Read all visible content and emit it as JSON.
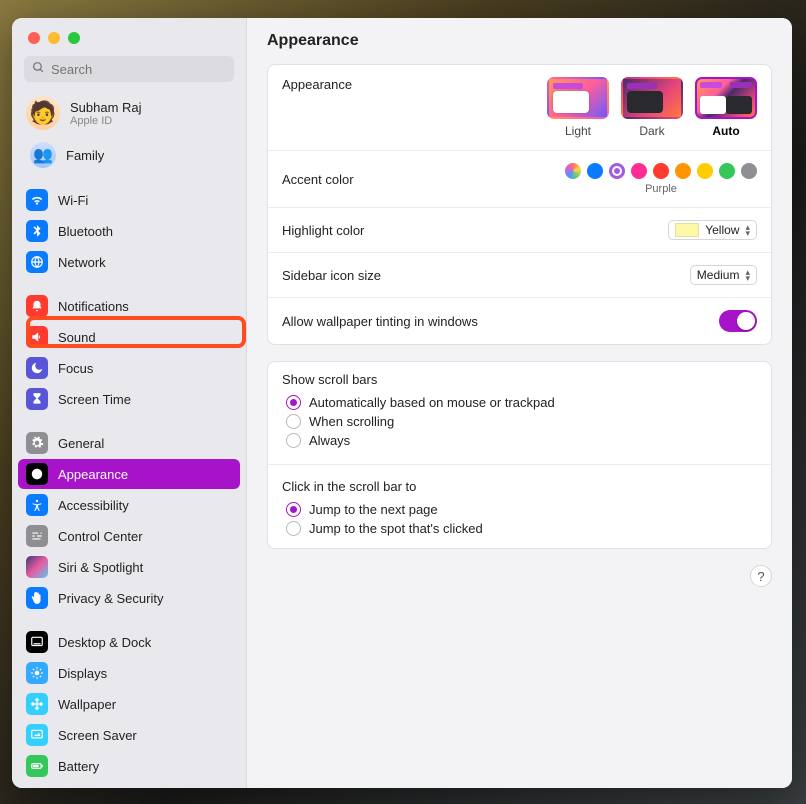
{
  "search": {
    "placeholder": "Search"
  },
  "account": {
    "name": "Subham Raj",
    "sub": "Apple ID",
    "family": "Family"
  },
  "sidebar_groups": [
    [
      {
        "id": "wifi",
        "label": "Wi-Fi",
        "color": "#0a7bff",
        "icon": "wifi"
      },
      {
        "id": "bluetooth",
        "label": "Bluetooth",
        "color": "#0a7bff",
        "icon": "bluetooth"
      },
      {
        "id": "network",
        "label": "Network",
        "color": "#0a7bff",
        "icon": "globe"
      }
    ],
    [
      {
        "id": "notifications",
        "label": "Notifications",
        "color": "#ff3b30",
        "icon": "bell",
        "annotated": true
      },
      {
        "id": "sound",
        "label": "Sound",
        "color": "#ff3b30",
        "icon": "speaker"
      },
      {
        "id": "focus",
        "label": "Focus",
        "color": "#5856d6",
        "icon": "moon"
      },
      {
        "id": "screen-time",
        "label": "Screen Time",
        "color": "#5856d6",
        "icon": "hourglass"
      }
    ],
    [
      {
        "id": "general",
        "label": "General",
        "color": "#8e8e93",
        "icon": "gear"
      },
      {
        "id": "appearance",
        "label": "Appearance",
        "color": "#000000",
        "icon": "appearance",
        "selected": true
      },
      {
        "id": "accessibility",
        "label": "Accessibility",
        "color": "#0a7bff",
        "icon": "accessibility"
      },
      {
        "id": "control-center",
        "label": "Control Center",
        "color": "#8e8e93",
        "icon": "sliders"
      },
      {
        "id": "siri",
        "label": "Siri & Spotlight",
        "color": "#000000",
        "icon": "siri",
        "multi": true
      },
      {
        "id": "privacy",
        "label": "Privacy & Security",
        "color": "#0a7bff",
        "icon": "hand"
      }
    ],
    [
      {
        "id": "desktop-dock",
        "label": "Desktop & Dock",
        "color": "#000000",
        "icon": "dock"
      },
      {
        "id": "displays",
        "label": "Displays",
        "color": "#33aaff",
        "icon": "sun"
      },
      {
        "id": "wallpaper",
        "label": "Wallpaper",
        "color": "#33cfff",
        "icon": "flower"
      },
      {
        "id": "screen-saver",
        "label": "Screen Saver",
        "color": "#33cfff",
        "icon": "screensaver"
      },
      {
        "id": "battery",
        "label": "Battery",
        "color": "#34c759",
        "icon": "battery"
      }
    ]
  ],
  "main": {
    "title": "Appearance",
    "appearance_label": "Appearance",
    "themes": [
      {
        "id": "light",
        "label": "Light"
      },
      {
        "id": "dark",
        "label": "Dark"
      },
      {
        "id": "auto",
        "label": "Auto",
        "selected": true
      }
    ],
    "accent_label": "Accent color",
    "accent_colors": [
      {
        "id": "multicolor",
        "hex": "multi"
      },
      {
        "id": "blue",
        "hex": "#0a7bff"
      },
      {
        "id": "purple",
        "hex": "#a55ae0",
        "selected": true
      },
      {
        "id": "pink",
        "hex": "#ff2d92"
      },
      {
        "id": "red",
        "hex": "#ff3b30"
      },
      {
        "id": "orange",
        "hex": "#ff9500"
      },
      {
        "id": "yellow",
        "hex": "#ffcc00"
      },
      {
        "id": "green",
        "hex": "#34c759"
      },
      {
        "id": "graphite",
        "hex": "#8e8e93"
      }
    ],
    "accent_selected_name": "Purple",
    "highlight_label": "Highlight color",
    "highlight_value": "Yellow",
    "sidebar_icon_label": "Sidebar icon size",
    "sidebar_icon_value": "Medium",
    "wallpaper_tint_label": "Allow wallpaper tinting in windows",
    "wallpaper_tint_on": true,
    "scroll_bars": {
      "title": "Show scroll bars",
      "options": [
        "Automatically based on mouse or trackpad",
        "When scrolling",
        "Always"
      ],
      "selected": 0
    },
    "scroll_click": {
      "title": "Click in the scroll bar to",
      "options": [
        "Jump to the next page",
        "Jump to the spot that's clicked"
      ],
      "selected": 0
    },
    "help": "?"
  }
}
